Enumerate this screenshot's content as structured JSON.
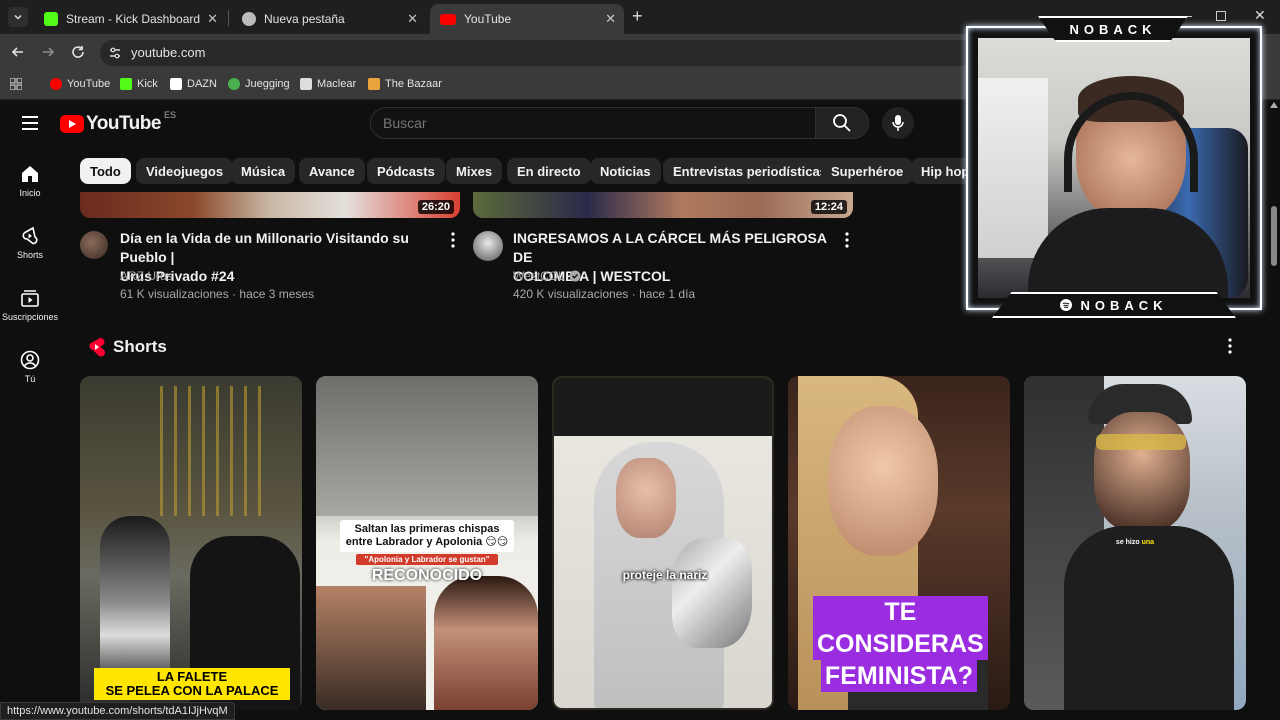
{
  "browser": {
    "tabs": [
      {
        "label": "Stream - Kick Dashboard",
        "favicon": "kick-icon",
        "color": "#53fc18"
      },
      {
        "label": "Nueva pestaña",
        "favicon": "chrome-icon",
        "color": "#bbbbbb"
      },
      {
        "label": "YouTube",
        "favicon": "youtube-icon",
        "color": "#ff0000"
      }
    ],
    "url": "youtube.com",
    "bookmarks": [
      {
        "label": "YouTube",
        "color": "#ff0000"
      },
      {
        "label": "Kick",
        "color": "#53fc18"
      },
      {
        "label": "DAZN",
        "color": "#ffffff"
      },
      {
        "label": "Juegging",
        "color": "#4caf50"
      },
      {
        "label": "Maclear",
        "color": "#dddddd"
      },
      {
        "label": "The Bazaar",
        "color": "#e8a33d"
      }
    ],
    "status_url": "https://www.youtube.com/shorts/tdA1IJjHvqM"
  },
  "youtube": {
    "logo_text": "YouTube",
    "region": "ES",
    "search_placeholder": "Buscar",
    "chips": [
      "Todo",
      "Videojuegos",
      "Música",
      "Avance",
      "Pódcasts",
      "Mixes",
      "En directo",
      "Noticias",
      "Entrevistas periodísticas",
      "Superhéroe",
      "Hip hop"
    ],
    "sidebar": [
      {
        "label": "Inicio",
        "icon": "home-icon"
      },
      {
        "label": "Shorts",
        "icon": "shorts-icon"
      },
      {
        "label": "Suscripciones",
        "icon": "subscriptions-icon"
      },
      {
        "label": "Tú",
        "icon": "you-icon"
      }
    ],
    "videos": [
      {
        "title_line1": "Día en la Vida de un Millonario Visitando su Pueblo |",
        "title_line2": "Urus Privado #24",
        "channel": "ARZ Urus",
        "meta": "61 K visualizaciones · hace 3 meses",
        "duration": "26:20",
        "verified": false
      },
      {
        "title_line1": "INGRESAMOS A LA CÁRCEL MÁS PELIGROSA DE",
        "title_line2": "COLOMBIA | WESTCOL",
        "channel": "WestCOL",
        "meta": "420 K visualizaciones · hace 1 día",
        "duration": "12:24",
        "verified": true
      }
    ],
    "shorts_heading": "Shorts",
    "shorts": [
      {
        "caption1": "LA FALETE",
        "caption2": "SE PELEA CON LA PALACE"
      },
      {
        "caption1": "Saltan las primeras chispas",
        "caption2": "entre Labrador y Apolonia 😏😏",
        "caption3": "\"Apolonia y Labrador se gustan\"",
        "caption4": "RECONOCIDO"
      },
      {
        "caption1": "proteje la nariz"
      },
      {
        "caption1": "TE CONSIDERAS",
        "caption2": "FEMINISTA?"
      },
      {
        "caption1": "se hizo",
        "caption2": "una"
      }
    ]
  },
  "overlay": {
    "streamer_name_top": "NOBACK",
    "streamer_name_bottom": "NOBACK"
  }
}
